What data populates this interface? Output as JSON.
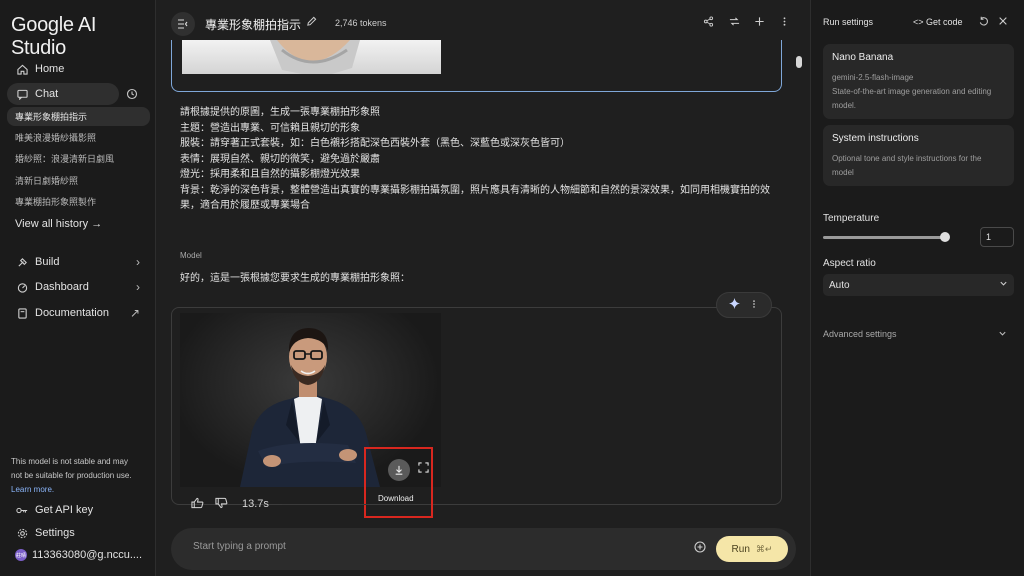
{
  "app": {
    "name": "Google AI Studio"
  },
  "sidebar": {
    "home": "Home",
    "chat": "Chat",
    "history": [
      "專業形象棚拍指示",
      "唯美浪漫婚紗攝影照",
      "婚紗照：浪漫清新日劇風",
      "清新日劇婚紗照",
      "專業棚拍形象照製作"
    ],
    "view_all": "View all history",
    "view_all_arrow": "→",
    "build": "Build",
    "dashboard": "Dashboard",
    "documentation": "Documentation",
    "chevron": "›",
    "external": "↗",
    "disclaimer_text": "This model is not stable and may not be suitable for production use.",
    "disclaimer_link": "Learn more.",
    "get_api_key": "Get API key",
    "settings": "Settings",
    "account": "113363080@g.nccu....",
    "avatar_initials": "莊晴"
  },
  "header": {
    "title": "專業形象棚拍指示",
    "tokens": "2,746 tokens"
  },
  "conversation": {
    "prompt_lines": [
      "請根據提供的原圖，生成一張專業棚拍形象照",
      "主題：營造出專業、可信賴且親切的形象",
      "服裝：請穿著正式套裝，如：白色襯衫搭配深色西裝外套（黑色、深藍色或深灰色皆可）",
      "表情：展現自然、親切的微笑，避免過於嚴肅",
      "燈光：採用柔和且自然的攝影棚燈光效果",
      "背景：乾淨的深色背景，整體營造出真實的專業攝影棚拍攝氛圍，照片應具有清晰的人物細節和自然的景深效果，如同用相機實拍的效果，適合用於履歷或專業場合"
    ],
    "model_label": "Model",
    "model_reply": "好的，這是一張根據您要求生成的專業棚拍形象照：",
    "download_tooltip": "Download",
    "timing": "13.7s"
  },
  "prompt": {
    "placeholder": "Start typing a prompt",
    "run_label": "Run",
    "run_shortcut": "⌘↵"
  },
  "right_panel": {
    "title": "Run settings",
    "get_code": "Get code",
    "model_card": {
      "name": "Nano Banana",
      "id": "gemini-2.5-flash-image",
      "description": "State-of-the-art image generation and editing model."
    },
    "system_card": {
      "title": "System instructions",
      "description": "Optional tone and style instructions for the model"
    },
    "temperature_label": "Temperature",
    "temperature_value": "1",
    "temperature_fraction": 1.0,
    "aspect_ratio_label": "Aspect ratio",
    "aspect_ratio_value": "Auto",
    "advanced_settings": "Advanced settings"
  },
  "colors": {
    "run_button": "#f5e6a8",
    "highlight_box": "#d8271f",
    "accent_border": "#7fa7d8"
  }
}
